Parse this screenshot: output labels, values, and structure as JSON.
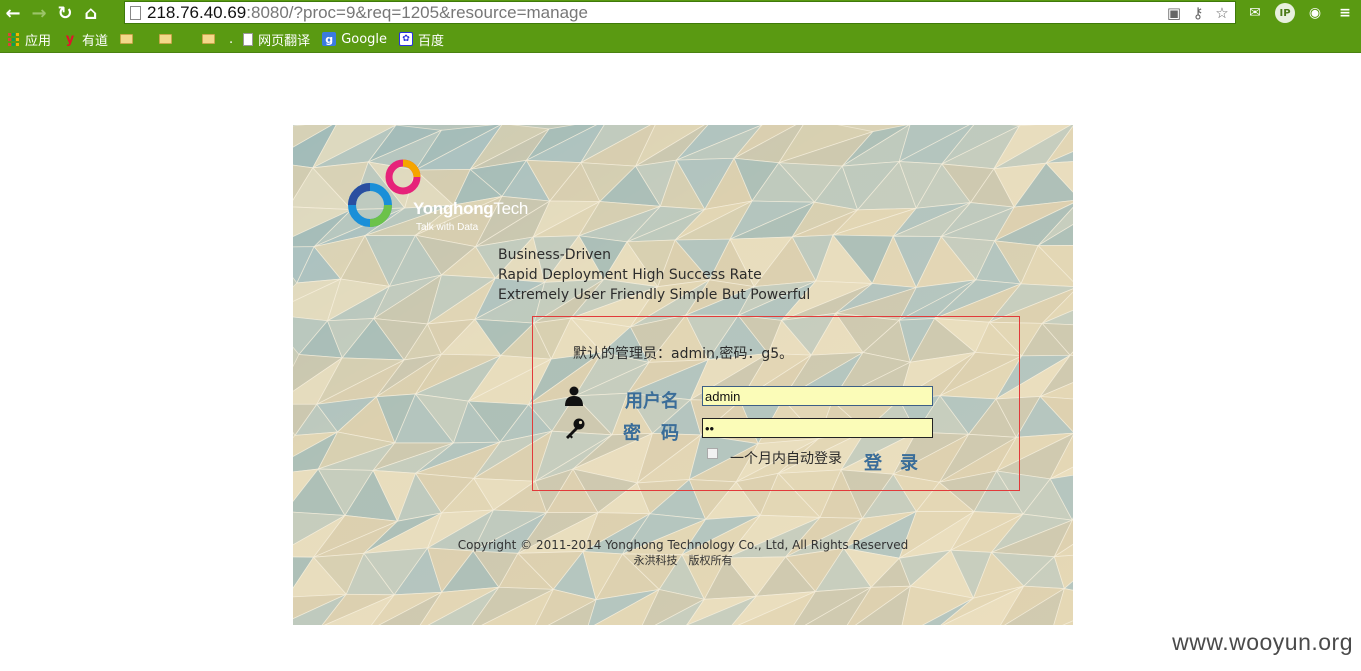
{
  "browser": {
    "url_host": "218.76.40.69",
    "url_rest": ":8080/?proc=9&req=1205&resource=manage"
  },
  "bookmarks": {
    "apps": "应用",
    "youdao": "有道",
    "dot": ".",
    "translate": "网页翻译",
    "google": "Google",
    "baidu": "百度"
  },
  "brand": {
    "name_bold": "Yonghong",
    "name_light": "Tech",
    "slogan": "Talk with Data"
  },
  "taglines": [
    "Business-Driven",
    "Rapid Deployment High Success Rate",
    "Extremely User Friendly Simple But Powerful"
  ],
  "login": {
    "hint": "默认的管理员：admin,密码：g5。",
    "username_label": "用户名",
    "password_label": "密码",
    "username_value": "admin",
    "password_value": "••",
    "remember_label": "一个月内自动登录",
    "remember_checked": false,
    "submit_label": "登录"
  },
  "footer": {
    "copyright": "Copyright © 2011-2014 Yonghong Technology Co., Ltd, All Rights Reserved",
    "rights": "永洪科技　版权所有"
  },
  "watermark": "www.wooyun.org"
}
